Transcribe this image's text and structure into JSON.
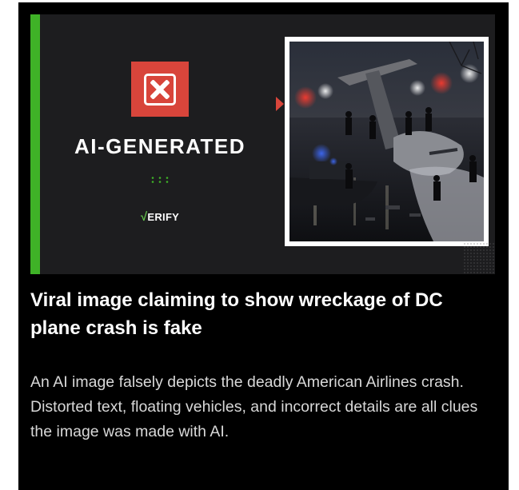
{
  "banner": {
    "label": "AI-GENERATED",
    "brand_check": "√",
    "brand_text": "ERIFY"
  },
  "article": {
    "headline": "Viral image claiming to show wreckage of DC plane crash is fake",
    "summary": "An AI image falsely depicts the deadly American Airlines crash. Distorted text, floating vehicles, and incorrect details are all clues the image was made with AI."
  },
  "icons": {
    "status": "close-icon",
    "pointer": "triangle-right-icon"
  },
  "colors": {
    "accent_green": "#3fb227",
    "alert_red": "#d8453b",
    "background": "#000000",
    "banner_bg": "#1d1d1f"
  }
}
